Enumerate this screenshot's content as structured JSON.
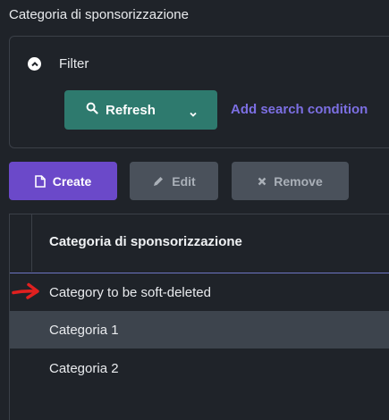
{
  "page": {
    "title": "Categoria di sponsorizzazione"
  },
  "filter": {
    "label": "Filter",
    "refresh_label": "Refresh",
    "add_condition_label": "Add search condition"
  },
  "toolbar": {
    "create_label": "Create",
    "edit_label": "Edit",
    "remove_label": "Remove"
  },
  "table": {
    "column_header": "Categoria di sponsorizzazione",
    "rows": [
      "Category to be soft-deleted",
      "Categoria 1",
      "Categoria 2"
    ]
  },
  "colors": {
    "background": "#1f2329",
    "refresh_button": "#2e7a6e",
    "create_button": "#6b49c9",
    "disabled_button": "#4a515b",
    "link": "#7c6fe3",
    "selected_border": "#6c74c2",
    "stripe_row": "#3d444d",
    "annotation_arrow": "#e0201f"
  },
  "icons": {
    "filter_toggle": "chevron-up-circle-icon",
    "refresh": "search-icon",
    "refresh_menu": "chevron-down-icon",
    "create": "file-icon",
    "edit": "pencil-icon",
    "remove": "x-icon",
    "annotation": "red-arrow-icon"
  }
}
